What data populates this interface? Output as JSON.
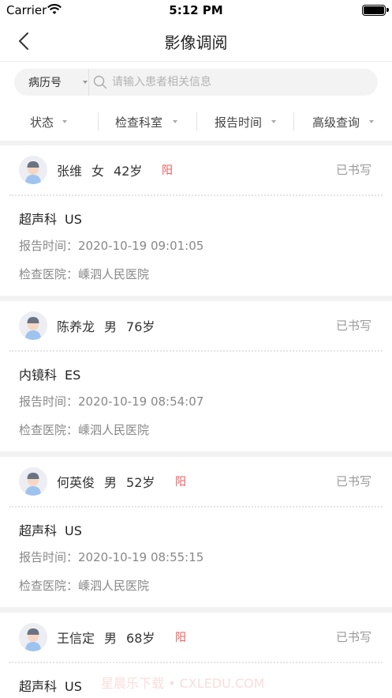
{
  "status_bar": {
    "carrier": "Carrier",
    "time": "5:12 PM"
  },
  "nav": {
    "title": "影像调阅"
  },
  "search": {
    "type_label": "病历号",
    "placeholder": "请输入患者相关信息",
    "value": ""
  },
  "filters": [
    {
      "label": "状态"
    },
    {
      "label": "检查科室"
    },
    {
      "label": "报告时间"
    },
    {
      "label": "高级查询"
    }
  ],
  "records": [
    {
      "name": "张维",
      "gender": "女",
      "age": "42岁",
      "tag": "阳",
      "status": "已书写",
      "department": "超声科",
      "modality": "US",
      "report_time": "报告时间：2020-10-19 09:01:05",
      "hospital": "检查医院：嵊泗人民医院"
    },
    {
      "name": "陈养龙",
      "gender": "男",
      "age": "76岁",
      "tag": "",
      "status": "已书写",
      "department": "内镜科",
      "modality": "ES",
      "report_time": "报告时间：2020-10-19 08:54:07",
      "hospital": "检查医院：嵊泗人民医院"
    },
    {
      "name": "何英俊",
      "gender": "男",
      "age": "52岁",
      "tag": "阳",
      "status": "已书写",
      "department": "超声科",
      "modality": "US",
      "report_time": "报告时间：2020-10-19 08:55:15",
      "hospital": "检查医院：嵊泗人民医院"
    },
    {
      "name": "王信定",
      "gender": "男",
      "age": "68岁",
      "tag": "阳",
      "status": "已书写",
      "department": "超声科",
      "modality": "US",
      "report_time": "",
      "hospital": ""
    }
  ],
  "watermark": "星晨乐下载 • CXLEDU.COM",
  "colors": {
    "background": "#f2f2f2",
    "card": "#ffffff",
    "positive_tag": "#f05a5a",
    "muted_text": "#888888",
    "status_text": "#999999"
  },
  "icons": {
    "back": "chevron-left-icon",
    "search": "search-icon",
    "dropdown": "caret-down-icon",
    "avatar": "doctor-avatar-icon",
    "wifi": "wifi-icon",
    "battery": "battery-icon"
  }
}
